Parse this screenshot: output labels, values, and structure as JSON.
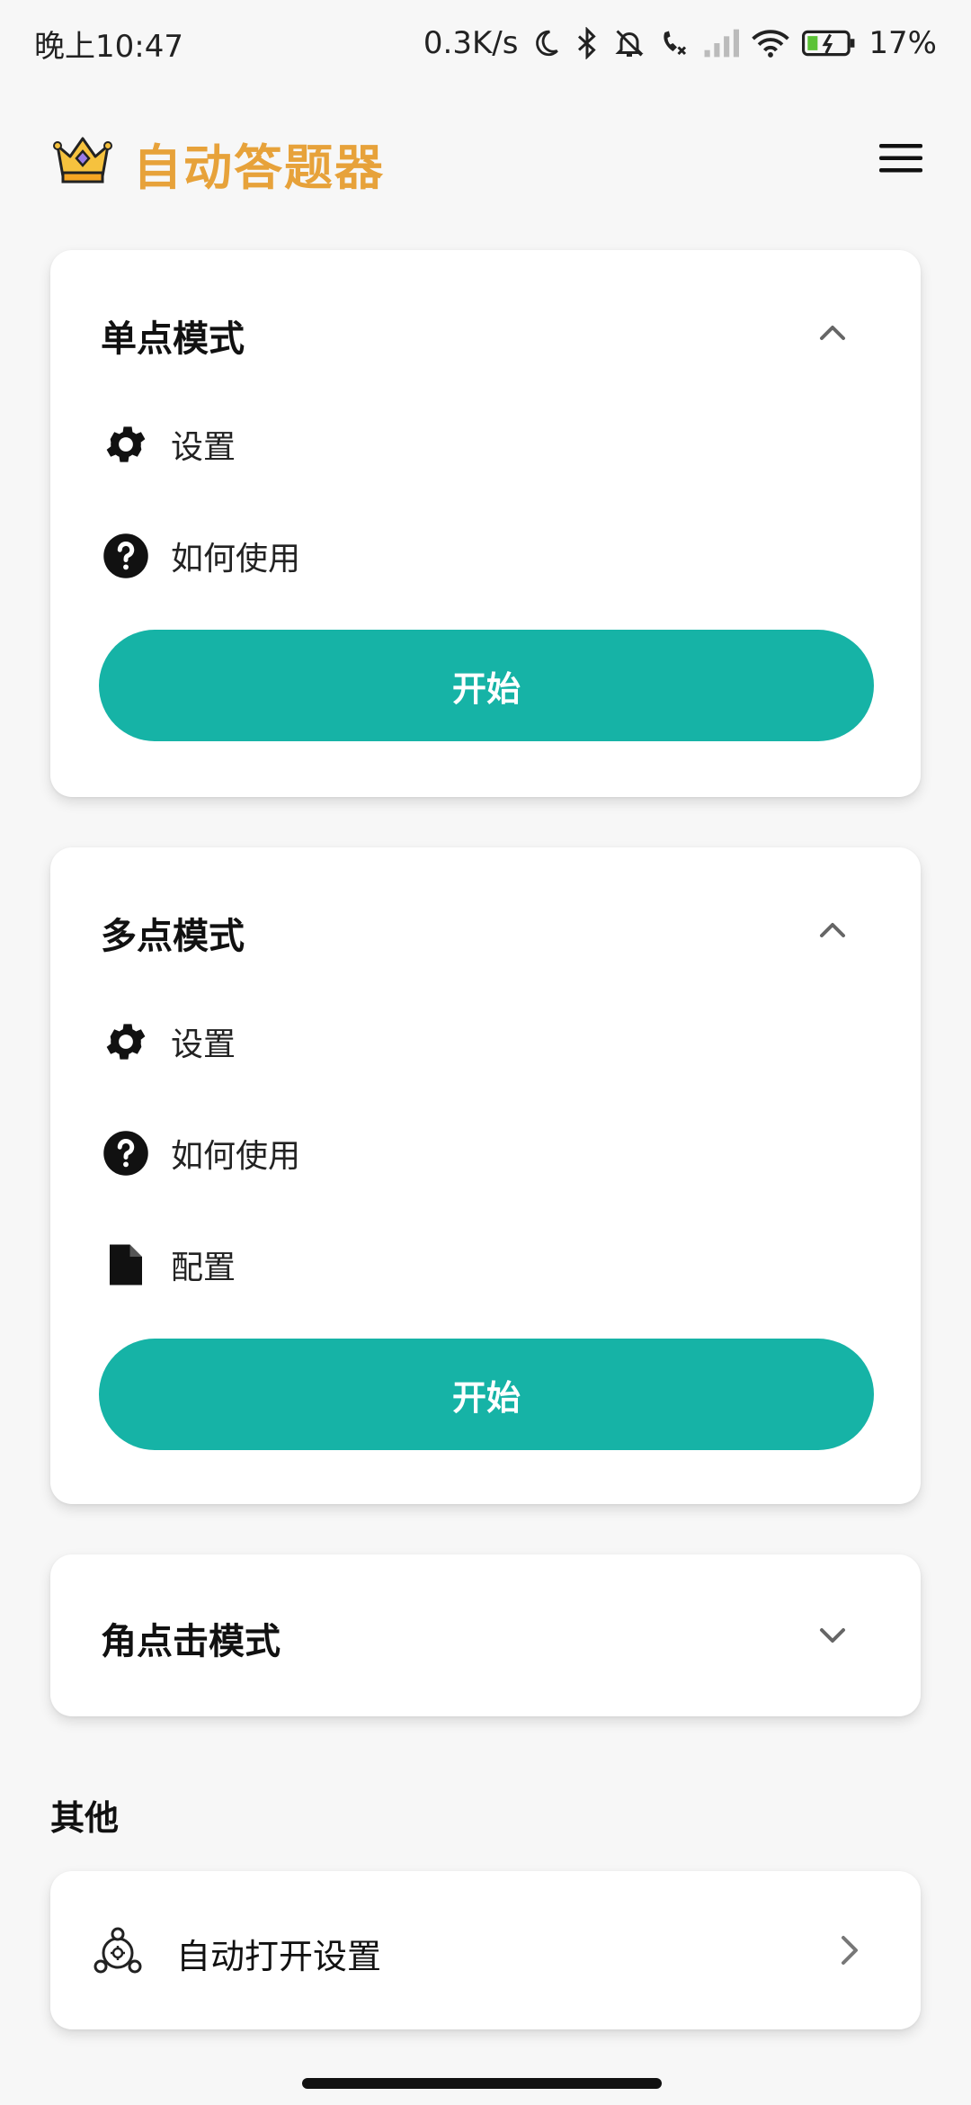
{
  "status_bar": {
    "time": "晚上10:47",
    "network_speed": "0.3K/s",
    "battery": "17%",
    "icons": [
      "moon-icon",
      "bluetooth-icon",
      "bell-off-icon",
      "call-missed-icon",
      "signal-icon",
      "wifi-icon",
      "battery-icon"
    ]
  },
  "app_bar": {
    "title": "自动答题器",
    "logo_icon": "crown-icon",
    "menu_icon": "hamburger-menu-icon"
  },
  "sections": [
    {
      "title": "单点模式",
      "expanded": true,
      "items": [
        {
          "icon": "gear-icon",
          "label": "设置"
        },
        {
          "icon": "help-icon",
          "label": "如何使用"
        }
      ],
      "button_label": "开始"
    },
    {
      "title": "多点模式",
      "expanded": true,
      "items": [
        {
          "icon": "gear-icon",
          "label": "设置"
        },
        {
          "icon": "help-icon",
          "label": "如何使用"
        },
        {
          "icon": "file-icon",
          "label": "配置"
        }
      ],
      "button_label": "开始"
    },
    {
      "title": "角点击模式",
      "expanded": false
    }
  ],
  "other": {
    "heading": "其他",
    "item_label": "自动打开设置",
    "item_icon": "settings-share-icon"
  },
  "colors": {
    "accent": "#16b3a6",
    "title": "#e7a23a",
    "background": "#f7f7f7"
  }
}
